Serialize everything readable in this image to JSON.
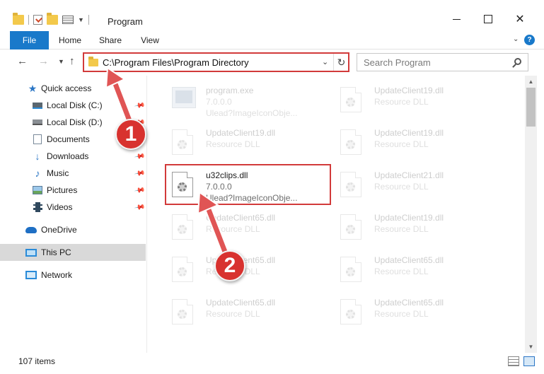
{
  "window": {
    "title": "Program"
  },
  "ribbon": {
    "tabs": [
      "File",
      "Home",
      "Share",
      "View"
    ]
  },
  "navigation": {
    "address": "C:\\Program Files\\Program Directory",
    "search_placeholder": "Search Program"
  },
  "sidebar": {
    "items": [
      {
        "label": "Quick access",
        "icon": "star-icon",
        "pinned": false
      },
      {
        "label": "Local Disk (C:)",
        "icon": "drive-icon",
        "pinned": true
      },
      {
        "label": "Local Disk (D:)",
        "icon": "drive-icon",
        "pinned": true
      },
      {
        "label": "Documents",
        "icon": "documents-icon",
        "pinned": true
      },
      {
        "label": "Downloads",
        "icon": "downloads-icon",
        "pinned": true
      },
      {
        "label": "Music",
        "icon": "music-icon",
        "pinned": true
      },
      {
        "label": "Pictures",
        "icon": "pictures-icon",
        "pinned": true
      },
      {
        "label": "Videos",
        "icon": "videos-icon",
        "pinned": true
      },
      {
        "label": "OneDrive",
        "icon": "onedrive-icon",
        "pinned": false
      },
      {
        "label": "This PC",
        "icon": "computer-icon",
        "pinned": false,
        "selected": true
      },
      {
        "label": "Network",
        "icon": "network-icon",
        "pinned": false
      }
    ]
  },
  "files": [
    {
      "name": "program.exe",
      "line1": "7.0.0.0",
      "line2": "Ulead?ImageIconObje...",
      "faded": true,
      "icon": "exe-icon"
    },
    {
      "name": "UpdateClient19.dll",
      "line1": "Resource DLL",
      "line2": "",
      "faded": true,
      "icon": "dll-icon"
    },
    {
      "name": "UpdateClient19.dll",
      "line1": "Resource DLL",
      "line2": "",
      "faded": true,
      "icon": "dll-icon"
    },
    {
      "name": "UpdateClient19.dll",
      "line1": "Resource DLL",
      "line2": "",
      "faded": true,
      "icon": "dll-icon"
    },
    {
      "name": "u32clips.dll",
      "line1": "7.0.0.0",
      "line2": "Ulead?ImageIconObje...",
      "faded": false,
      "icon": "dll-icon"
    },
    {
      "name": "UpdateClient21.dll",
      "line1": "Resource DLL",
      "line2": "",
      "faded": true,
      "icon": "dll-icon"
    },
    {
      "name": "UpdateClient65.dll",
      "line1": "Resource DLL",
      "line2": "",
      "faded": true,
      "icon": "dll-icon"
    },
    {
      "name": "UpdateClient19.dll",
      "line1": "Resource DLL",
      "line2": "",
      "faded": true,
      "icon": "dll-icon"
    },
    {
      "name": "UpdateClient65.dll",
      "line1": "Resource DLL",
      "line2": "",
      "faded": true,
      "icon": "dll-icon"
    },
    {
      "name": "UpdateClient65.dll",
      "line1": "Resource DLL",
      "line2": "",
      "faded": true,
      "icon": "dll-icon"
    },
    {
      "name": "UpdateClient65.dll",
      "line1": "Resource DLL",
      "line2": "",
      "faded": true,
      "icon": "dll-icon"
    },
    {
      "name": "UpdateClient65.dll",
      "line1": "Resource DLL",
      "line2": "",
      "faded": true,
      "icon": "dll-icon"
    }
  ],
  "status": {
    "item_count": "107 items"
  },
  "annotations": {
    "step1": "1",
    "step2": "2",
    "highlight_color": "#d23a3a",
    "arrow_color": "#e05555"
  },
  "colors": {
    "accent": "#1979ca",
    "selection": "#d9d9d9"
  }
}
